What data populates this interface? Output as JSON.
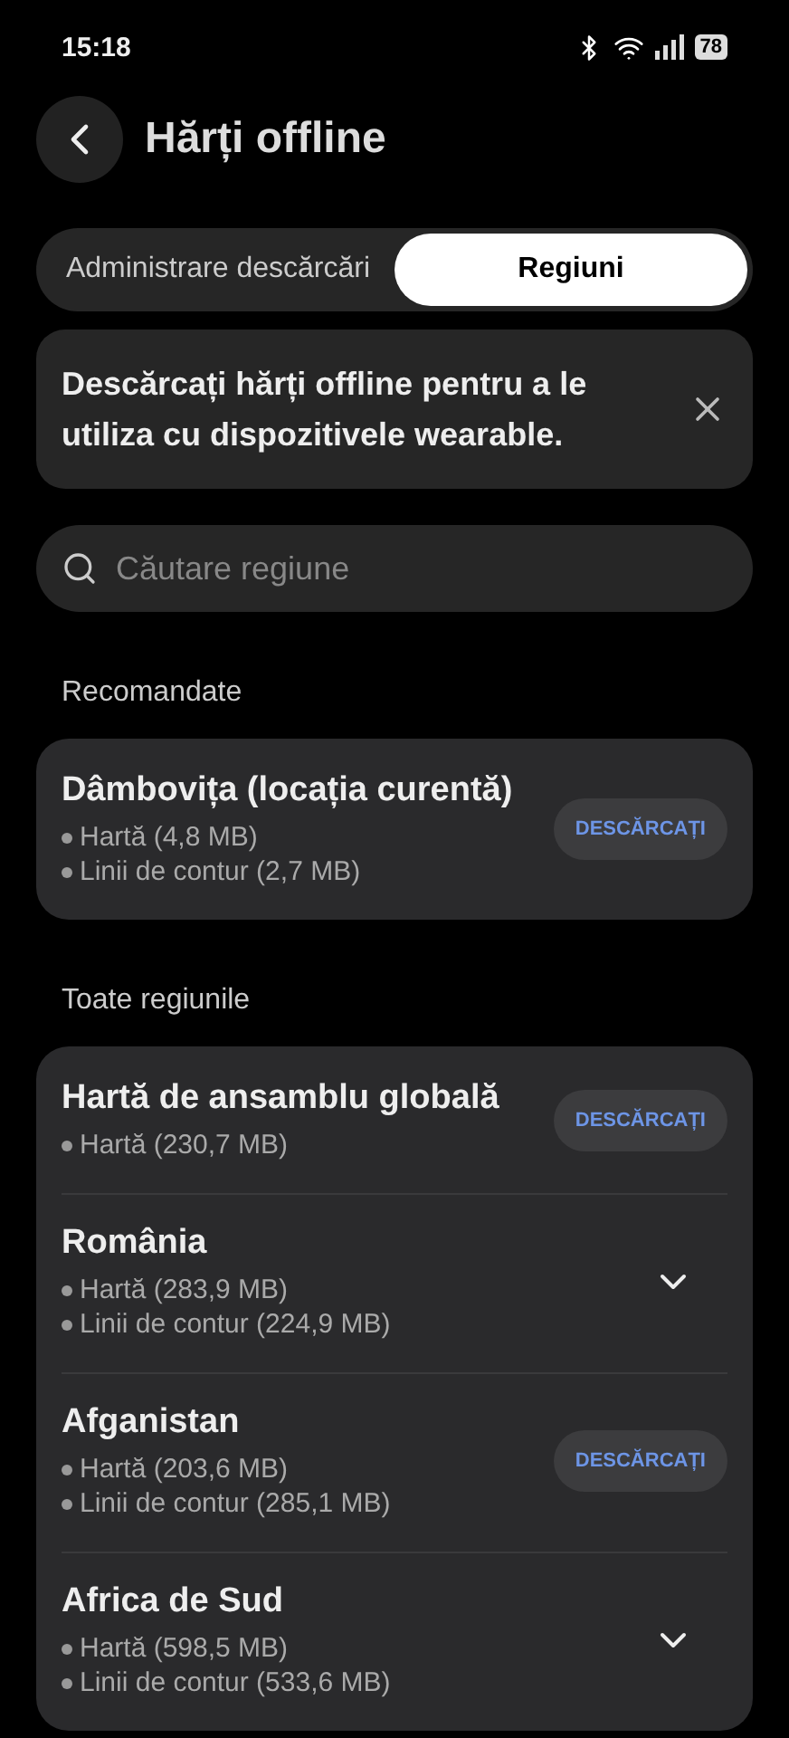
{
  "status_bar": {
    "time": "15:18",
    "battery": "78"
  },
  "header": {
    "title": "Hărți offline"
  },
  "tabs": [
    {
      "label": "Administrare descărcări",
      "selected": false
    },
    {
      "label": "Regiuni",
      "selected": true
    }
  ],
  "banner": {
    "text": "Descărcați hărți offline pentru a le utiliza cu dispozitivele wearable."
  },
  "search": {
    "placeholder": "Căutare regiune"
  },
  "sections": [
    {
      "title": "Recomandate",
      "regions": [
        {
          "name": "Dâmbovița (locația curentă)",
          "details": [
            "Hartă (4,8 MB)",
            "Linii de contur (2,7 MB)"
          ],
          "kind": "download",
          "action": "DESCĂRCAȚI"
        }
      ]
    },
    {
      "title": "Toate regiunile",
      "regions": [
        {
          "name": "Hartă de ansamblu globală",
          "details": [
            "Hartă (230,7 MB)"
          ],
          "kind": "download",
          "action": "DESCĂRCAȚI"
        },
        {
          "name": "România",
          "details": [
            "Hartă (283,9 MB)",
            "Linii de contur (224,9 MB)"
          ],
          "kind": "expand"
        },
        {
          "name": "Afganistan",
          "details": [
            "Hartă (203,6 MB)",
            "Linii de contur (285,1 MB)"
          ],
          "kind": "download",
          "action": "DESCĂRCAȚI"
        },
        {
          "name": "Africa de Sud",
          "details": [
            "Hartă (598,5 MB)",
            "Linii de contur (533,6 MB)"
          ],
          "kind": "expand"
        }
      ]
    }
  ]
}
